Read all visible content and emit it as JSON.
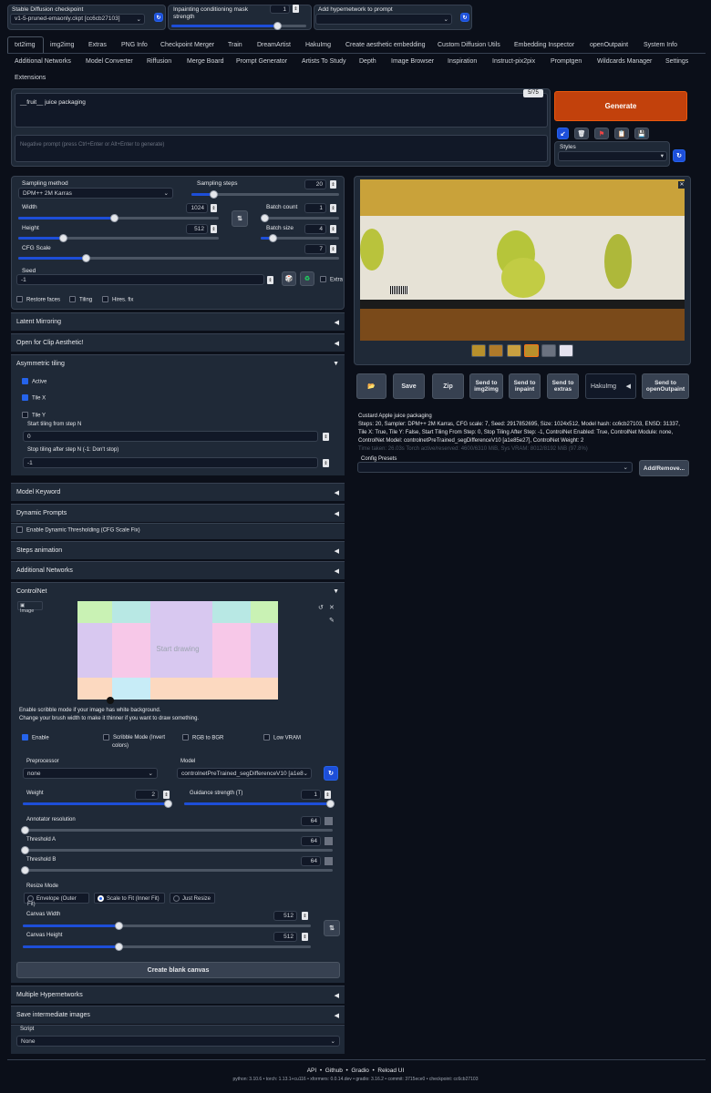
{
  "top": {
    "checkpoint_label": "Stable Diffusion checkpoint",
    "checkpoint_value": "v1-5-pruned-emaonly.ckpt [cc6cb27103]",
    "mask_strength_label": "Inpainting conditioning mask strength",
    "mask_strength_value": "1",
    "hypernetwork_label": "Add hypernetwork to prompt"
  },
  "tabs_row1": [
    "txt2img",
    "img2img",
    "Extras",
    "PNG Info",
    "Checkpoint Merger",
    "Train",
    "DreamArtist",
    "HakuImg",
    "Create aesthetic embedding",
    "Custom Diffusion Utils",
    "Embedding Inspector",
    "openOutpaint",
    "System Info"
  ],
  "tabs_row2": [
    "Additional Networks",
    "Model Converter",
    "Riffusion",
    "Merge Board",
    "Prompt Generator",
    "Artists To Study",
    "Depth",
    "Image Browser",
    "Inspiration",
    "Instruct-pix2pix",
    "Promptgen",
    "Wildcards Manager",
    "Settings"
  ],
  "tabs_row3": [
    "Extensions"
  ],
  "prompt": {
    "value": "__fruit__ juice packaging",
    "token_count": "5/75",
    "negative_placeholder": "Negative prompt (press Ctrl+Enter or Alt+Enter to generate)",
    "generate_label": "Generate",
    "styles_label": "Styles"
  },
  "settings": {
    "sampling_method_label": "Sampling method",
    "sampling_method_value": "DPM++ 2M Karras",
    "sampling_steps_label": "Sampling steps",
    "sampling_steps_value": "20",
    "width_label": "Width",
    "width_value": "1024",
    "height_label": "Height",
    "height_value": "512",
    "batch_count_label": "Batch count",
    "batch_count_value": "1",
    "batch_size_label": "Batch size",
    "batch_size_value": "4",
    "cfg_label": "CFG Scale",
    "cfg_value": "7",
    "seed_label": "Seed",
    "seed_value": "-1",
    "extra_label": "Extra",
    "restore_faces": "Restore faces",
    "tiling": "Tiling",
    "hires_fix": "Hires. fix"
  },
  "accordions": {
    "latent_mirroring": "Latent Mirroring",
    "clip_aesthetic": "Open for Clip Aesthetic!",
    "asymmetric_tiling": "Asymmetric tiling",
    "model_keyword": "Model Keyword",
    "dynamic_prompts": "Dynamic Prompts",
    "steps_animation": "Steps animation",
    "additional_networks": "Additional Networks",
    "controlnet": "ControlNet",
    "multiple_hypernetworks": "Multiple Hypernetworks",
    "save_intermediate": "Save intermediate images"
  },
  "asym": {
    "active": "Active",
    "tile_x": "Tile X",
    "tile_y": "Tile Y",
    "start_label": "Start tiling from step N",
    "start_value": "0",
    "stop_label": "Stop tiling after step N (-1: Don't stop)",
    "stop_value": "-1"
  },
  "dynamic_threshold": "Enable Dynamic Thresholding (CFG Scale Fix)",
  "controlnet": {
    "image_label": "Image",
    "canvas_text": "Start drawing",
    "note_line1": "Enable scribble mode if your image has white background.",
    "note_line2": "Change your brush width to make it thinner if you want to draw something.",
    "enable": "Enable",
    "scribble_mode": "Scribble Mode (Invert colors)",
    "rgb_to_bgr": "RGB to BGR",
    "low_vram": "Low VRAM",
    "preprocessor_label": "Preprocessor",
    "preprocessor_value": "none",
    "model_label": "Model",
    "model_value": "controlnetPreTrained_segDifferenceV10 [a1e85",
    "weight_label": "Weight",
    "weight_value": "2",
    "guidance_label": "Guidance strength (T)",
    "guidance_value": "1",
    "annotator_label": "Annotator resolution",
    "annotator_value": "64",
    "threshold_a_label": "Threshold A",
    "threshold_a_value": "64",
    "threshold_b_label": "Threshold B",
    "threshold_b_value": "64",
    "resize_label": "Resize Mode",
    "resize_options": [
      "Envelope (Outer Fit)",
      "Scale to Fit (Inner Fit)",
      "Just Resize"
    ],
    "canvas_width_label": "Canvas Width",
    "canvas_width_value": "512",
    "canvas_height_label": "Canvas Height",
    "canvas_height_value": "512",
    "create_canvas": "Create blank canvas"
  },
  "script": {
    "label": "Script",
    "value": "None"
  },
  "output": {
    "buttons": [
      "Save",
      "Zip",
      "Send to img2img",
      "Send to inpaint",
      "Send to extras"
    ],
    "hakuimg": "HakuImg",
    "send_outpaint": "Send to openOutpaint",
    "info_title": "Custard Apple juice packaging",
    "info_params": "Steps: 20, Sampler: DPM++ 2M Karras, CFG scale: 7, Seed: 2917852695, Size: 1024x512, Model hash: cc6cb27103, ENSD: 31337, Tile X: True, Tile Y: False, Start Tiling From Step: 0, Stop Tiling After Step: -1, ControlNet Enabled: True, ControlNet Module: none, ControlNet Model: controlnetPreTrained_segDifferenceV10 [a1e85e27], ControlNet Weight: 2",
    "time_taken": "Time taken: 26.03s  Torch active/reserved: 4600/6310 MiB, Sys VRAM: 8012/8192 MiB (97.8%)",
    "config_presets": "Config Presets",
    "add_remove": "Add/Remove..."
  },
  "footer": {
    "links": [
      "API",
      "Github",
      "Gradio",
      "Reload UI"
    ],
    "versions": "python: 3.10.6  •  torch: 1.13.1+cu116  •  xformers: 0.0.14.dev  •  gradio: 3.16.2  •  commit: 3715ece0  •  checkpoint: cc6cb27103"
  },
  "colors": {
    "accent": "#1d4ed8",
    "generate": "#c2410c",
    "bg": "#0b0f19",
    "panel": "#1f2937"
  }
}
